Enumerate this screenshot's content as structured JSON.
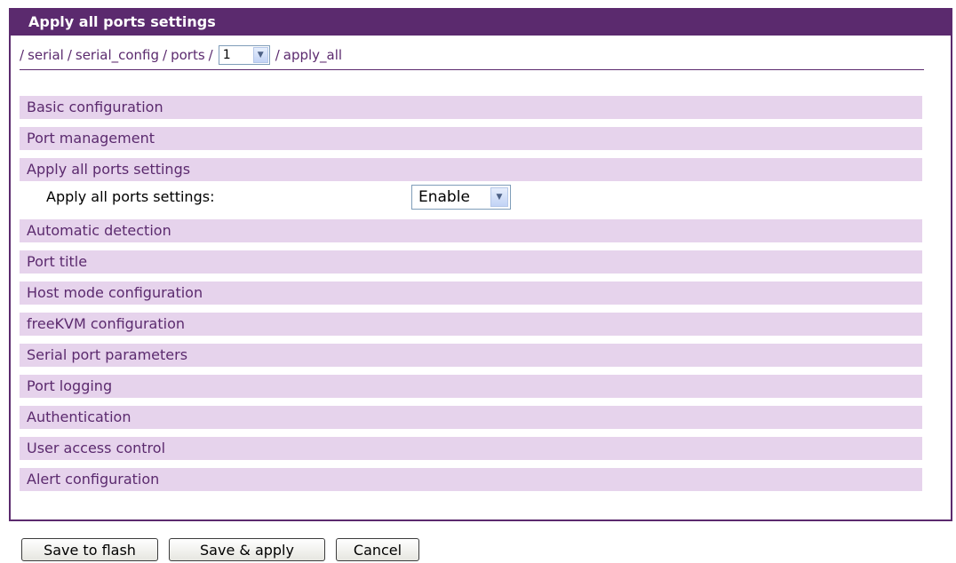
{
  "header": {
    "title": "Apply all ports settings"
  },
  "breadcrumb": {
    "lead_sep": "/",
    "items": [
      "serial",
      "serial_config",
      "ports"
    ],
    "sep": "/",
    "port_select_value": "1",
    "tail": "apply_all"
  },
  "sections": [
    "Basic configuration",
    "Port management",
    "Apply all ports settings",
    "Automatic detection",
    "Port title",
    "Host mode configuration",
    "freeKVM configuration",
    "Serial port parameters",
    "Port logging",
    "Authentication",
    "User access control",
    "Alert configuration"
  ],
  "field": {
    "label": "Apply all ports settings:",
    "value": "Enable"
  },
  "buttons": {
    "save_flash": "Save to flash",
    "save_apply": "Save & apply",
    "cancel": "Cancel"
  },
  "colors": {
    "accent": "#5b2a6e",
    "row_bg": "#e6d3ec"
  }
}
